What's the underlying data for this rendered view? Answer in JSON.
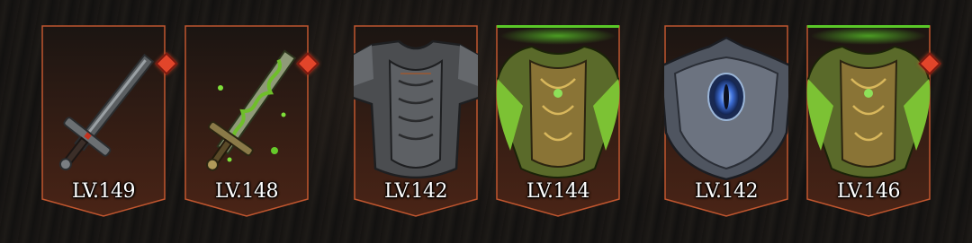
{
  "equipment": [
    {
      "level": "LV.149",
      "icon": "sword-icon",
      "rarity_color": "#e2452a",
      "badge": true
    },
    {
      "level": "LV.148",
      "icon": "vine-sword-icon",
      "rarity_color": "#e2452a",
      "badge": true
    },
    {
      "level": "LV.142",
      "icon": "iron-chestplate-icon",
      "badge": false
    },
    {
      "level": "LV.144",
      "icon": "leaf-chestplate-icon",
      "badge": false,
      "glow_color": "#5ac828"
    },
    {
      "level": "LV.142",
      "icon": "eye-shield-icon",
      "badge": false
    },
    {
      "level": "LV.146",
      "icon": "leaf-chestplate-icon",
      "rarity_color": "#e2452a",
      "badge": true,
      "glow_color": "#5ac828"
    }
  ]
}
